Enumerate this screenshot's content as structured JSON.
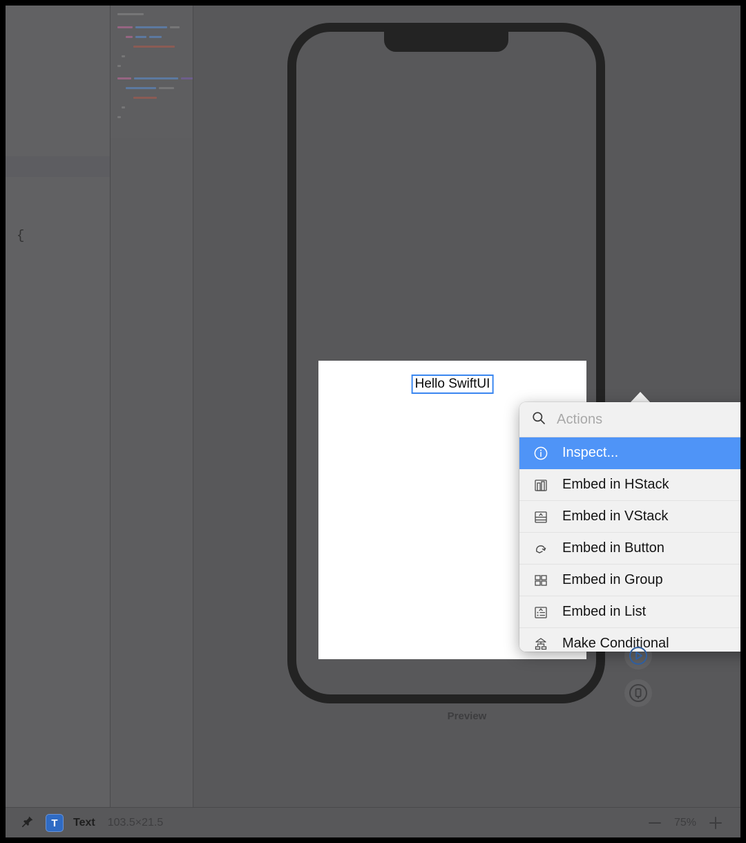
{
  "app": {
    "canvas_background": "#58585a",
    "accent_blue": "#4f94f7"
  },
  "editor": {
    "brace": "{"
  },
  "preview": {
    "label": "Preview",
    "selected_text": "Hello SwiftUI"
  },
  "controls": {
    "live_preview_icon": "play-circle-icon",
    "device_settings_icon": "device-circle-icon"
  },
  "popover": {
    "search": {
      "placeholder": "Actions",
      "value": "",
      "icon": "search-icon"
    },
    "items": [
      {
        "label": "Inspect...",
        "icon": "info-circle-icon",
        "selected": true
      },
      {
        "label": "Embed in HStack",
        "icon": "hstack-icon",
        "selected": false
      },
      {
        "label": "Embed in VStack",
        "icon": "vstack-icon",
        "selected": false
      },
      {
        "label": "Embed in Button",
        "icon": "button-icon",
        "selected": false
      },
      {
        "label": "Embed in Group",
        "icon": "group-icon",
        "selected": false
      },
      {
        "label": "Embed in List",
        "icon": "list-icon",
        "selected": false
      },
      {
        "label": "Make Conditional",
        "icon": "conditional-icon",
        "selected": false
      }
    ]
  },
  "statusbar": {
    "pin_icon": "pin-icon",
    "type_badge": "T",
    "type_label": "Text",
    "size_label": "103.5×21.5",
    "zoom_out_icon": "minus-icon",
    "zoom_level": "75%",
    "zoom_in_icon": "plus-icon"
  }
}
